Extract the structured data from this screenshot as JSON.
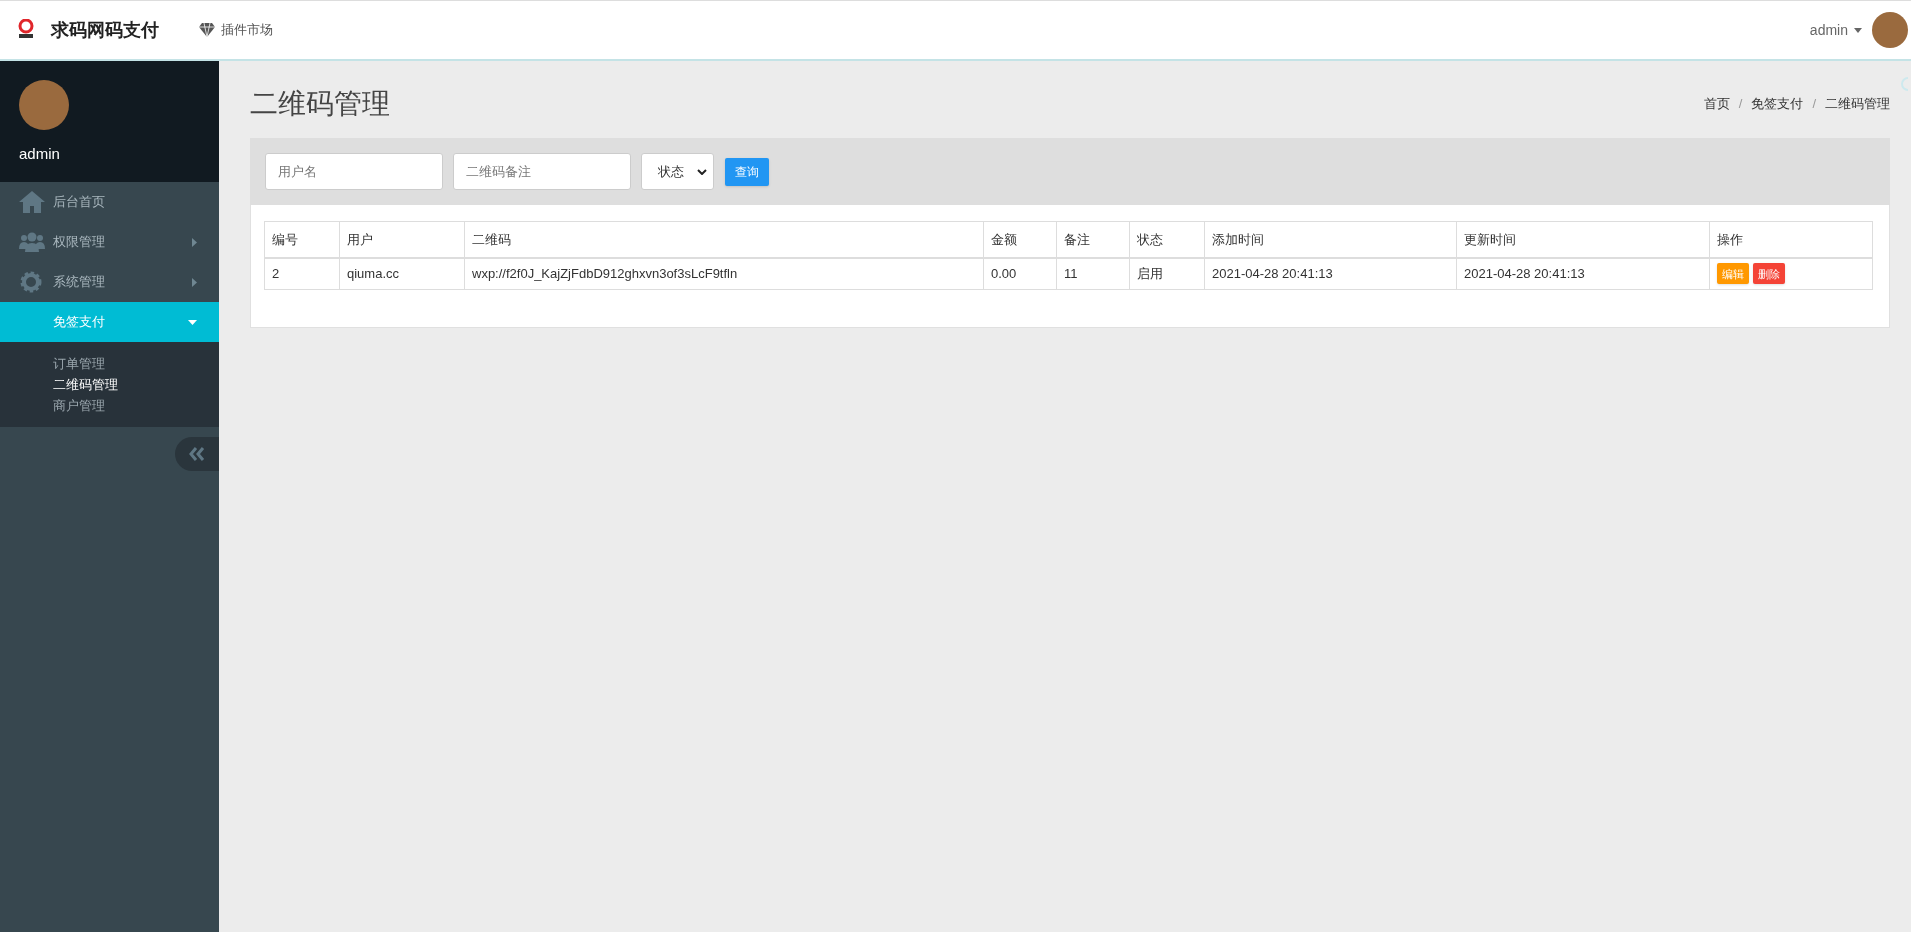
{
  "header": {
    "brand": "求码网码支付",
    "nav_link": "插件市场",
    "user": "admin"
  },
  "sidebar": {
    "user": "admin",
    "items": [
      {
        "label": "后台首页",
        "selected": false
      },
      {
        "label": "权限管理",
        "selected": false,
        "expanded": false
      },
      {
        "label": "系统管理",
        "selected": false,
        "expanded": false
      },
      {
        "label": "免签支付",
        "selected": true,
        "expanded": true,
        "children": [
          {
            "label": "订单管理",
            "selected": false
          },
          {
            "label": "二维码管理",
            "selected": true
          },
          {
            "label": "商户管理",
            "selected": false
          }
        ]
      }
    ]
  },
  "page": {
    "title": "二维码管理",
    "breadcrumb": [
      {
        "label": "首页",
        "separator": "/"
      },
      {
        "label": "免签支付",
        "separator": "/"
      },
      {
        "label": "二维码管理"
      }
    ]
  },
  "filters": {
    "username": {
      "placeholder": "用户名"
    },
    "remark": {
      "placeholder": "二维码备注"
    },
    "status": {
      "value": "状态"
    },
    "search_button": "查询"
  },
  "table": {
    "columns": [
      "编号",
      "用户",
      "二维码",
      "金额",
      "备注",
      "状态",
      "添加时间",
      "更新时间",
      "操作"
    ],
    "rows": [
      {
        "cells": [
          "2",
          "qiuma.cc",
          "wxp://f2f0J_KajZjFdbD912ghxvn3of3sLcF9tfln",
          "0.00",
          "11",
          "启用",
          "2021-04-28 20:41:13",
          "2021-04-28 20:41:13"
        ],
        "actions": [
          {
            "label": "编辑",
            "kind": "edit"
          },
          {
            "label": "删除",
            "kind": "delete"
          }
        ]
      }
    ]
  }
}
